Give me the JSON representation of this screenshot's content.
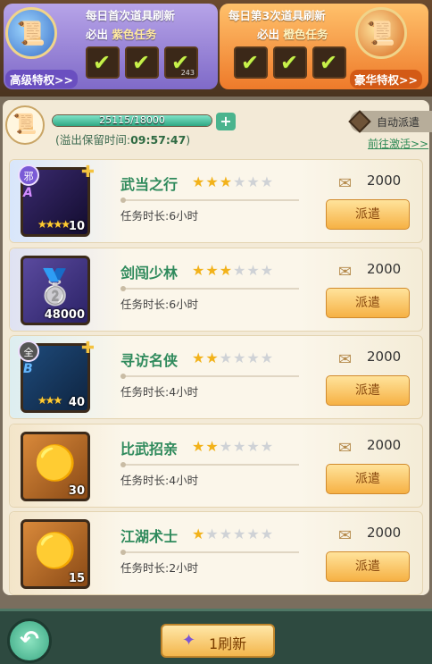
{
  "banners": {
    "left": {
      "line1": "每日首次道具刷新",
      "line2_prefix": "必出",
      "line2_highlight": "紫色任务",
      "privilege": "高级特权>>",
      "slot_nums": [
        "",
        "",
        "243"
      ]
    },
    "right": {
      "line1": "每日第3次道具刷新",
      "line2_prefix": "必出",
      "line2_highlight": "橙色任务",
      "privilege": "豪华特权>>",
      "slot_nums": [
        "",
        "",
        ""
      ]
    }
  },
  "status": {
    "progress_label": "25115/18000",
    "progress_fraction": 1.0,
    "overflow_label": "(溢出保留时间:",
    "overflow_time": "09:57:47",
    "overflow_suffix": ")",
    "auto_dispatch": "自动派遣",
    "goto_activate": "前往激活>>"
  },
  "tasks": [
    {
      "name": "武当之行",
      "rating": 3,
      "duration": "任务时长:6小时",
      "cost": "2000",
      "button": "派遣",
      "thumb_count": "10",
      "tag": "邪",
      "grade": "A",
      "thumb_stars": 4
    },
    {
      "name": "剑闯少林",
      "rating": 3,
      "duration": "任务时长:6小时",
      "cost": "2000",
      "button": "派遣",
      "thumb_count": "48000",
      "tag": "",
      "grade": "",
      "thumb_stars": 0
    },
    {
      "name": "寻访名侠",
      "rating": 2,
      "duration": "任务时长:4小时",
      "cost": "2000",
      "button": "派遣",
      "thumb_count": "40",
      "tag": "全",
      "grade": "B",
      "thumb_stars": 3
    },
    {
      "name": "比武招亲",
      "rating": 2,
      "duration": "任务时长:4小时",
      "cost": "2000",
      "button": "派遣",
      "thumb_count": "30",
      "tag": "",
      "grade": "",
      "thumb_stars": 0
    },
    {
      "name": "江湖术士",
      "rating": 1,
      "duration": "任务时长:2小时",
      "cost": "2000",
      "button": "派遣",
      "thumb_count": "15",
      "tag": "",
      "grade": "",
      "thumb_stars": 0
    }
  ],
  "task_rating_max": 6,
  "bottom": {
    "refresh_label": "1刷新"
  },
  "colors": {
    "task_name": "#2f8a5c",
    "star_on": "#f2b21a",
    "star_off": "#cfd2d6",
    "purple_panel": "#7f6ac8",
    "orange_panel": "#ee7a2a"
  }
}
